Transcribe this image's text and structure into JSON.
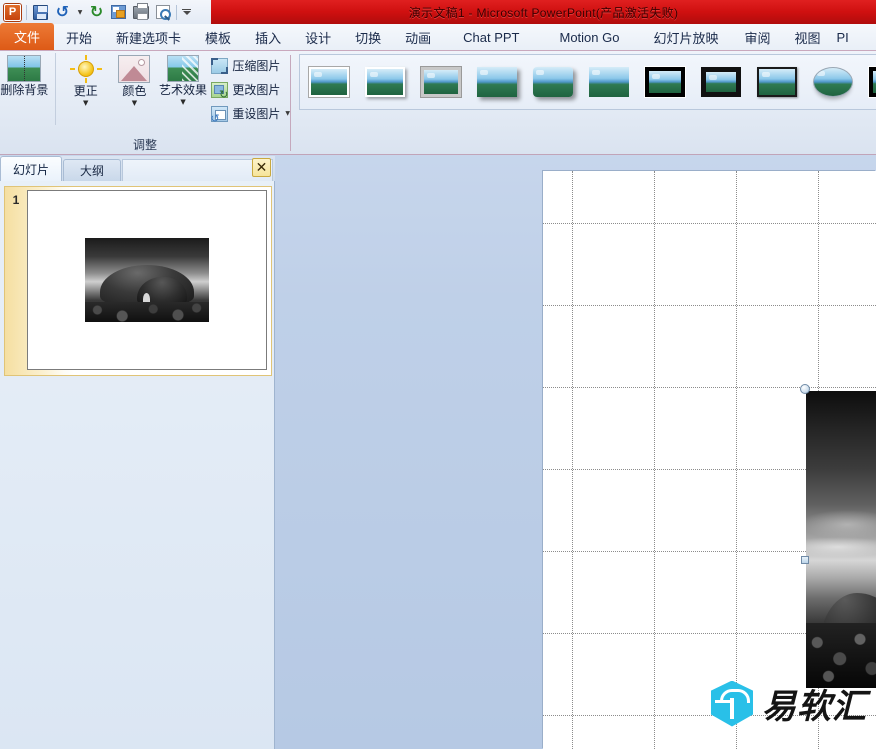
{
  "window": {
    "title": "演示文稿1  -  Microsoft PowerPoint(产品激活失败)",
    "accent_red": "#cf1010",
    "accent_orange": "#dd5a16"
  },
  "quick_access": {
    "logo_label": "P",
    "buttons": [
      {
        "name": "save-button",
        "icon": "save-icon",
        "label": "保存"
      },
      {
        "name": "undo-button",
        "icon": "undo-icon",
        "label": "撤消"
      },
      {
        "name": "undo-dropdown",
        "icon": "chevron-down-icon",
        "label": "▾"
      },
      {
        "name": "redo-button",
        "icon": "redo-icon",
        "label": "恢复"
      },
      {
        "name": "new-slide-button",
        "icon": "new-slide-icon",
        "label": "新建幻灯片"
      },
      {
        "name": "print-button",
        "icon": "printer-icon",
        "label": "快速打印"
      },
      {
        "name": "print-preview-button",
        "icon": "print-preview-icon",
        "label": "打印预览"
      },
      {
        "name": "customize-qat-button",
        "icon": "qat-dropdown-icon",
        "label": "自定义快速访问工具栏"
      }
    ]
  },
  "ribbon_tabs": [
    {
      "label": "文件",
      "active": true
    },
    {
      "label": "开始",
      "active": false
    },
    {
      "label": "新建选项卡",
      "active": false
    },
    {
      "label": "模板",
      "active": false
    },
    {
      "label": "插入",
      "active": false
    },
    {
      "label": "设计",
      "active": false
    },
    {
      "label": "切换",
      "active": false
    },
    {
      "label": "动画",
      "active": false
    },
    {
      "label": "Chat PPT",
      "active": false
    },
    {
      "label": "Motion Go",
      "active": false
    },
    {
      "label": "幻灯片放映",
      "active": false
    },
    {
      "label": "审阅",
      "active": false
    },
    {
      "label": "视图",
      "active": false
    },
    {
      "label": "PI",
      "active": false
    }
  ],
  "ribbon": {
    "adjust_group": {
      "label": "调整",
      "big_buttons": [
        {
          "label": "删除背景",
          "icon": "remove-background-icon",
          "has_caret": false
        },
        {
          "label": "更正",
          "icon": "corrections-icon",
          "has_caret": true
        },
        {
          "label": "颜色",
          "icon": "color-icon",
          "has_caret": true
        },
        {
          "label": "艺术效果",
          "icon": "artistic-effects-icon",
          "has_caret": true
        }
      ],
      "small_buttons": [
        {
          "label": "压缩图片",
          "icon": "compress-picture-icon",
          "has_caret": false
        },
        {
          "label": "更改图片",
          "icon": "change-picture-icon",
          "has_caret": false
        },
        {
          "label": "重设图片",
          "icon": "reset-picture-icon",
          "has_caret": true
        }
      ]
    },
    "picture_styles": {
      "items": [
        {
          "name": "style-simple-frame-white",
          "style": "st-simple"
        },
        {
          "name": "style-beveled-matte-white",
          "style": "st-beveled"
        },
        {
          "name": "style-metal-frame",
          "style": "st-frame-gray"
        },
        {
          "name": "style-drop-shadow-rectangle",
          "style": "st-drop"
        },
        {
          "name": "style-reflected-rounded-rectangle",
          "style": "st-drop-rr"
        },
        {
          "name": "style-soft-edge-rectangle",
          "style": "st-reflect"
        },
        {
          "name": "style-thick-matte-black",
          "style": "st-thickblack"
        },
        {
          "name": "style-simple-frame-black",
          "style": "st-blackmat"
        },
        {
          "name": "style-beveled-matte-black",
          "style": "st-blackthin"
        },
        {
          "name": "style-rotated-oval",
          "style": "st-oval"
        },
        {
          "name": "style-compound-frame-black",
          "style": "st-thickblack"
        }
      ]
    }
  },
  "panel": {
    "tabs": [
      {
        "label": "幻灯片",
        "active": true
      },
      {
        "label": "大纲",
        "active": false
      }
    ],
    "close_label": "✕",
    "slides": [
      {
        "number": "1",
        "thumbnail": "rock-formation-bw-photo"
      }
    ]
  },
  "canvas": {
    "gridline_columns": [
      29,
      111,
      193,
      275
    ],
    "gridline_rows": [
      52,
      134,
      216,
      298,
      380,
      462,
      544
    ],
    "selected_object": {
      "name": "picture-placeholder-cropped",
      "content": "rock-formation-bw-photo",
      "handles": [
        "top-left-rotate-circle",
        "middle-left-resize-square"
      ]
    }
  },
  "watermark": {
    "text": "易软汇",
    "logo_name": "yiruanhui-hex-logo",
    "logo_color": "#29c0e8"
  }
}
